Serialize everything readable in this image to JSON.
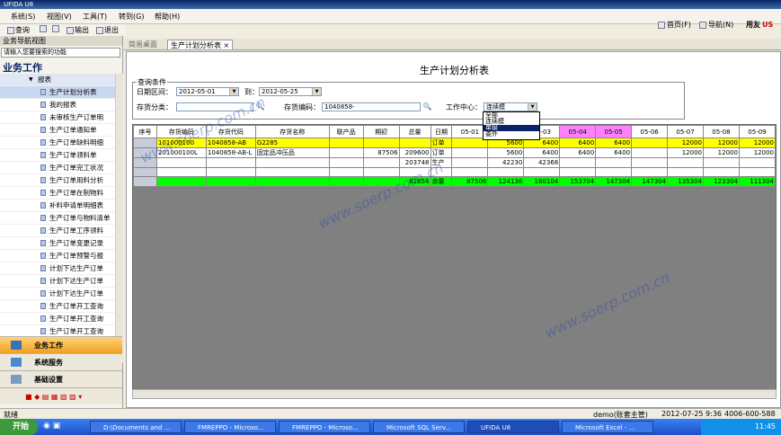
{
  "window": {
    "title": "UFIDA U8"
  },
  "menu": [
    "系统(S)",
    "视图(V)",
    "工具(T)",
    "转到(G)",
    "帮助(H)"
  ],
  "toolbar": {
    "query": "查询",
    "output": "输出",
    "exit": "退出"
  },
  "header_right": {
    "home": "首页(F)",
    "nav": "导航(N)",
    "brand": "用友"
  },
  "nav": {
    "title": "业务导航视图",
    "search_placeholder": "请输入您要搜索的功能",
    "section": "业务工作",
    "parent": "报表",
    "items": [
      "生产计划分析表",
      "我的报表",
      "未审核生产订单明",
      "生产订单通知单",
      "生产订单缺料明细",
      "生产订单领料单",
      "生产订单完工状况",
      "生产订单用料分析",
      "生产订单在制物料",
      "补料申请单明细表",
      "生产订单与物料清单",
      "生产订单工序领料",
      "生产订单变更记录",
      "生产订单预警与报",
      "计划下达生产订单",
      "计划下达生产订单",
      "计划下达生产订单",
      "生产订单开工查询",
      "生产订单开工查询",
      "生产订单开工查询"
    ],
    "buttons": [
      "业务工作",
      "系统服务",
      "基础设置"
    ]
  },
  "tabs": [
    "简易桌面",
    "生产计划分析表"
  ],
  "report": {
    "title": "生产计划分析表",
    "query_legend": "查询条件",
    "date_label": "日期区间：",
    "date_from": "2012-05-01",
    "to_label": "到：",
    "date_to": "2012-05-25",
    "category_label": "存货分类：",
    "code_label": "存货编码：",
    "code_value": "1040858-",
    "wc_label": "工作中心：",
    "wc_value": "连续模",
    "wc_options": [
      "全部",
      "连续模",
      "单级",
      "委外"
    ]
  },
  "grid": {
    "headers": [
      "序号",
      "存货编码",
      "存货代码",
      "存货名称",
      "联产品",
      "期初",
      "总量",
      "日期",
      "05-01",
      "05-02",
      "05-03",
      "05-04",
      "05-05",
      "05-06",
      "05-07",
      "05-08",
      "05-09"
    ],
    "rows": [
      [
        "",
        "101000100",
        "1040858-AB",
        "G2285",
        "",
        "",
        "",
        "订单",
        "",
        "5600",
        "6400",
        "6400",
        "6400",
        "",
        "12000",
        "12000",
        "12000"
      ],
      [
        "",
        "201000100L",
        "1040858-AB-L",
        "固定品冲压品",
        "",
        "87506",
        "209600",
        "订单",
        "",
        "5600",
        "6400",
        "6400",
        "6400",
        "",
        "12000",
        "12000",
        "12000"
      ],
      [
        "",
        "",
        "",
        "",
        "",
        "",
        "203748",
        "生产",
        "",
        "42230",
        "42368",
        "",
        "",
        "",
        "",
        "",
        ""
      ],
      [
        "",
        "",
        "",
        "",
        "",
        "",
        "81654",
        "余量",
        "87506",
        "124136",
        "160104",
        "153704",
        "147304",
        "147304",
        "135304",
        "123304",
        "111304"
      ]
    ]
  },
  "status": {
    "left": "就绪",
    "user": "demo(账套主管)",
    "date": "2012-07-25 9:36",
    "phone": "4006-600-588"
  },
  "taskbar": {
    "start": "开始",
    "tasks": [
      "D:\\Documents and ...",
      "FMREPPO - Microso...",
      "FMREPPO - Microso...",
      "Microsoft SQL Serv...",
      "UFIDA U8",
      "Microsoft Excel - ..."
    ],
    "clock": "11:45"
  },
  "watermark": "www.soerp.com.cn"
}
